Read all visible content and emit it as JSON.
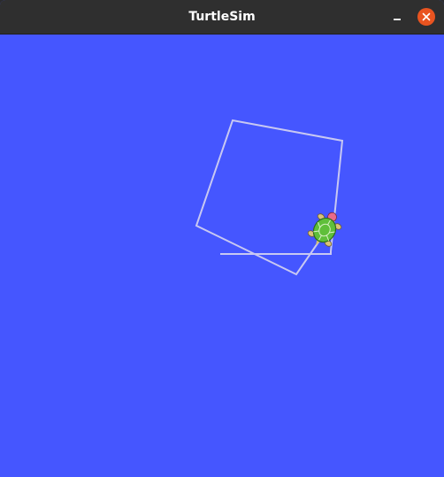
{
  "window": {
    "title": "TurtleSim",
    "background_color": "#4556ff",
    "titlebar_color": "#2f2f2f",
    "close_color": "#e95420"
  },
  "controls": {
    "minimize_icon": "minimize-icon",
    "close_icon": "close-icon"
  },
  "canvas": {
    "pen_color": "#c8c8f2",
    "turtle_icon": "turtle-icon"
  }
}
